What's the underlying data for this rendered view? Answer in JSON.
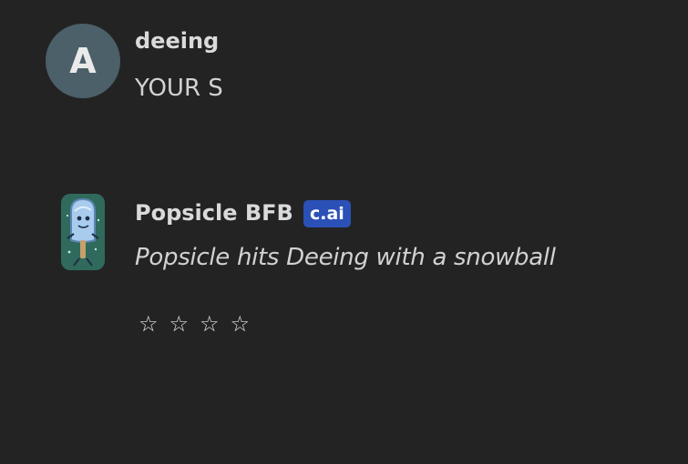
{
  "user_message": {
    "avatar_letter": "A",
    "author": "deeing",
    "text": "YOUR S"
  },
  "bot_message": {
    "author": "Popsicle BFB",
    "badge": "c.ai",
    "text": "Popsicle hits Deeing with a snowball",
    "avatar_icon": "popsicle-character-avatar"
  },
  "rating": {
    "stars": [
      "☆",
      "☆",
      "☆",
      "☆"
    ]
  },
  "colors": {
    "background": "#232323",
    "user_avatar_bg": "#4b6068",
    "badge_bg": "#2b50b6",
    "text": "#d6d6d6"
  }
}
